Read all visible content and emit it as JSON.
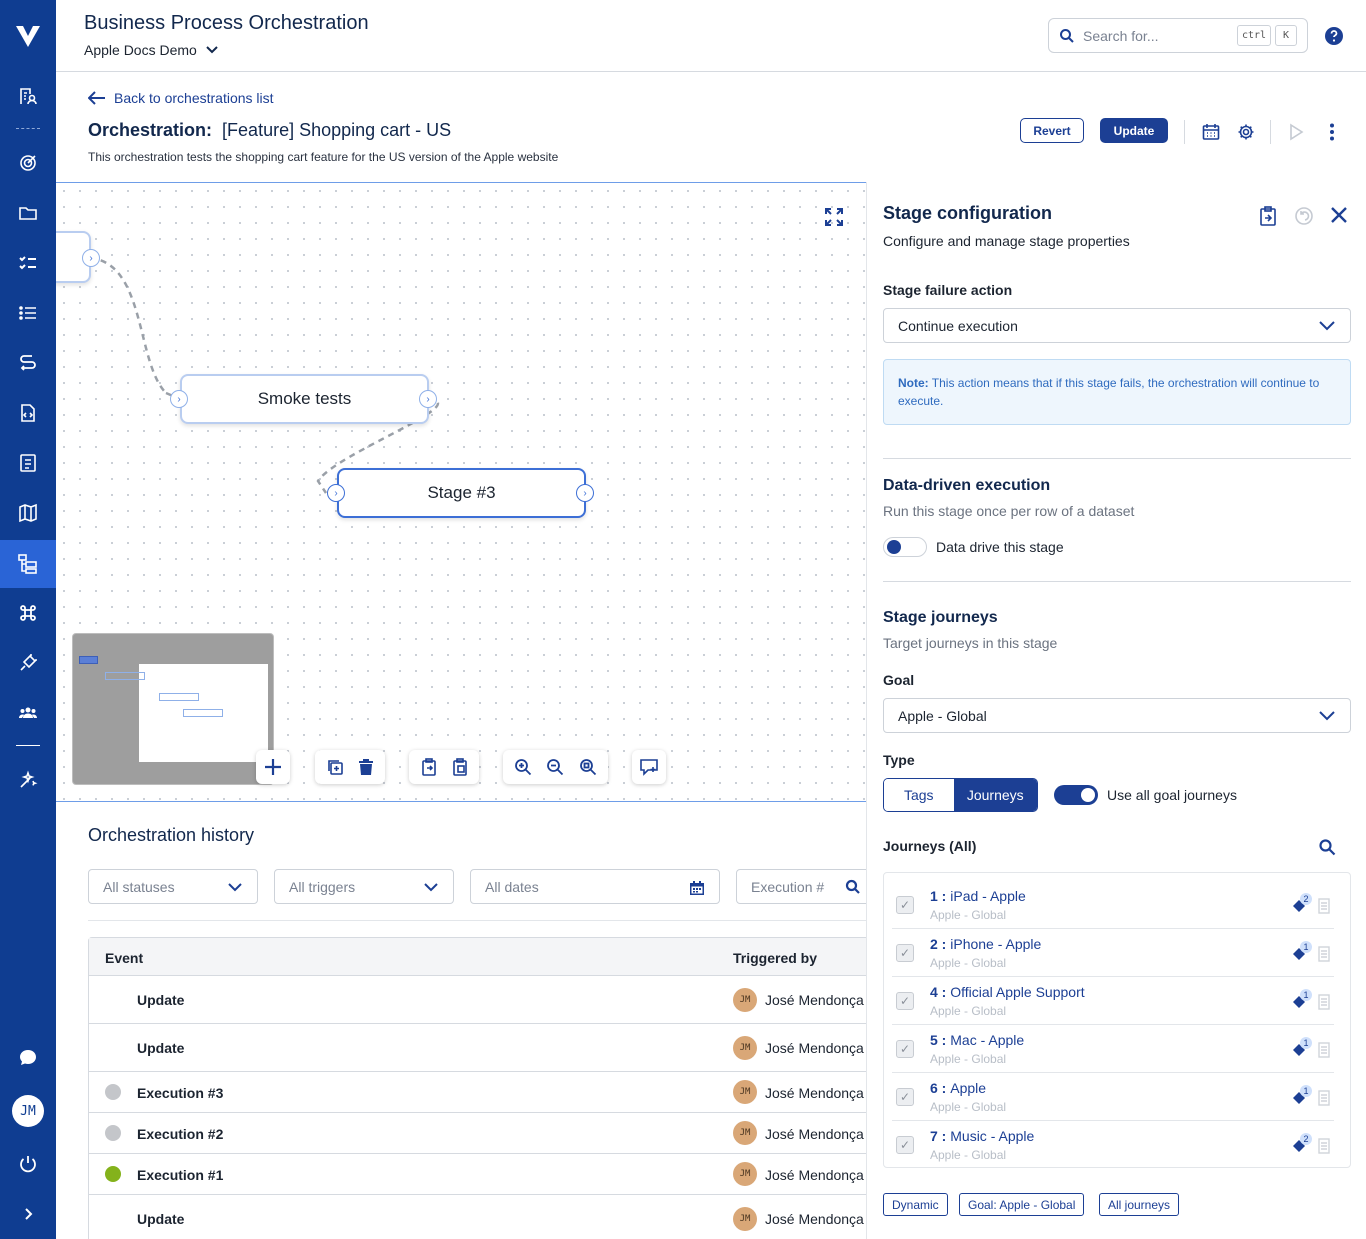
{
  "app": {
    "title": "Business Process Orchestration",
    "project": "Apple Docs Demo",
    "user_initials": "JM"
  },
  "search": {
    "placeholder": "Search for...",
    "kbd1": "ctrl",
    "kbd2": "K"
  },
  "header": {
    "back_label": "Back to orchestrations list",
    "title_prefix": "Orchestration:",
    "title": "[Feature] Shopping cart - US",
    "description": "This orchestration tests the shopping cart feature for the US version of the Apple website",
    "revert_label": "Revert",
    "update_label": "Update"
  },
  "canvas": {
    "nodes": [
      "Smoke tests",
      "Stage #3"
    ]
  },
  "history": {
    "title": "Orchestration history",
    "filters": {
      "status": "All statuses",
      "triggers": "All triggers",
      "dates": "All dates",
      "execution_placeholder": "Execution #"
    },
    "columns": {
      "event": "Event",
      "triggered_by": "Triggered by"
    },
    "rows": [
      {
        "event": "Update",
        "status": "",
        "user": "José Mendonça"
      },
      {
        "event": "Update",
        "status": "",
        "user": "José Mendonça"
      },
      {
        "event": "Execution #3",
        "status": "grey",
        "user": "José Mendonça"
      },
      {
        "event": "Execution #2",
        "status": "grey",
        "user": "José Mendonça"
      },
      {
        "event": "Execution #1",
        "status": "green",
        "user": "José Mendonça"
      },
      {
        "event": "Update",
        "status": "",
        "user": "José Mendonça"
      }
    ]
  },
  "panel": {
    "title": "Stage configuration",
    "subtitle": "Configure and manage stage properties",
    "failure_label": "Stage failure action",
    "failure_value": "Continue execution",
    "note_prefix": "Note:",
    "note_text": " This action means that if this stage fails, the orchestration will continue to execute.",
    "dd_title": "Data-driven execution",
    "dd_sub": "Run this stage once per row of a dataset",
    "dd_toggle_label": "Data drive this stage",
    "dd_toggle_on": false,
    "sj_title": "Stage journeys",
    "sj_sub": "Target journeys in this stage",
    "goal_label": "Goal",
    "goal_value": "Apple - Global",
    "type_label": "Type",
    "type_tags": "Tags",
    "type_journeys": "Journeys",
    "use_all_label": "Use all goal journeys",
    "use_all_on": true,
    "journeys_header": "Journeys (All)",
    "journeys": [
      {
        "num": "1",
        "name": "iPad - Apple",
        "goal": "Apple - Global",
        "count": "2"
      },
      {
        "num": "2",
        "name": "iPhone - Apple",
        "goal": "Apple - Global",
        "count": "1"
      },
      {
        "num": "4",
        "name": "Official Apple Support",
        "goal": "Apple - Global",
        "count": "1"
      },
      {
        "num": "5",
        "name": "Mac - Apple",
        "goal": "Apple - Global",
        "count": "1"
      },
      {
        "num": "6",
        "name": "Apple",
        "goal": "Apple - Global",
        "count": "1"
      },
      {
        "num": "7",
        "name": "Music - Apple",
        "goal": "Apple - Global",
        "count": "2"
      }
    ],
    "chips": [
      "Dynamic",
      "Goal: Apple - Global",
      "All journeys"
    ]
  },
  "colors": {
    "brand": "#0f3d91",
    "accent": "#1c3f94",
    "success": "#84b21b",
    "neutral": "#c4c6ca"
  }
}
